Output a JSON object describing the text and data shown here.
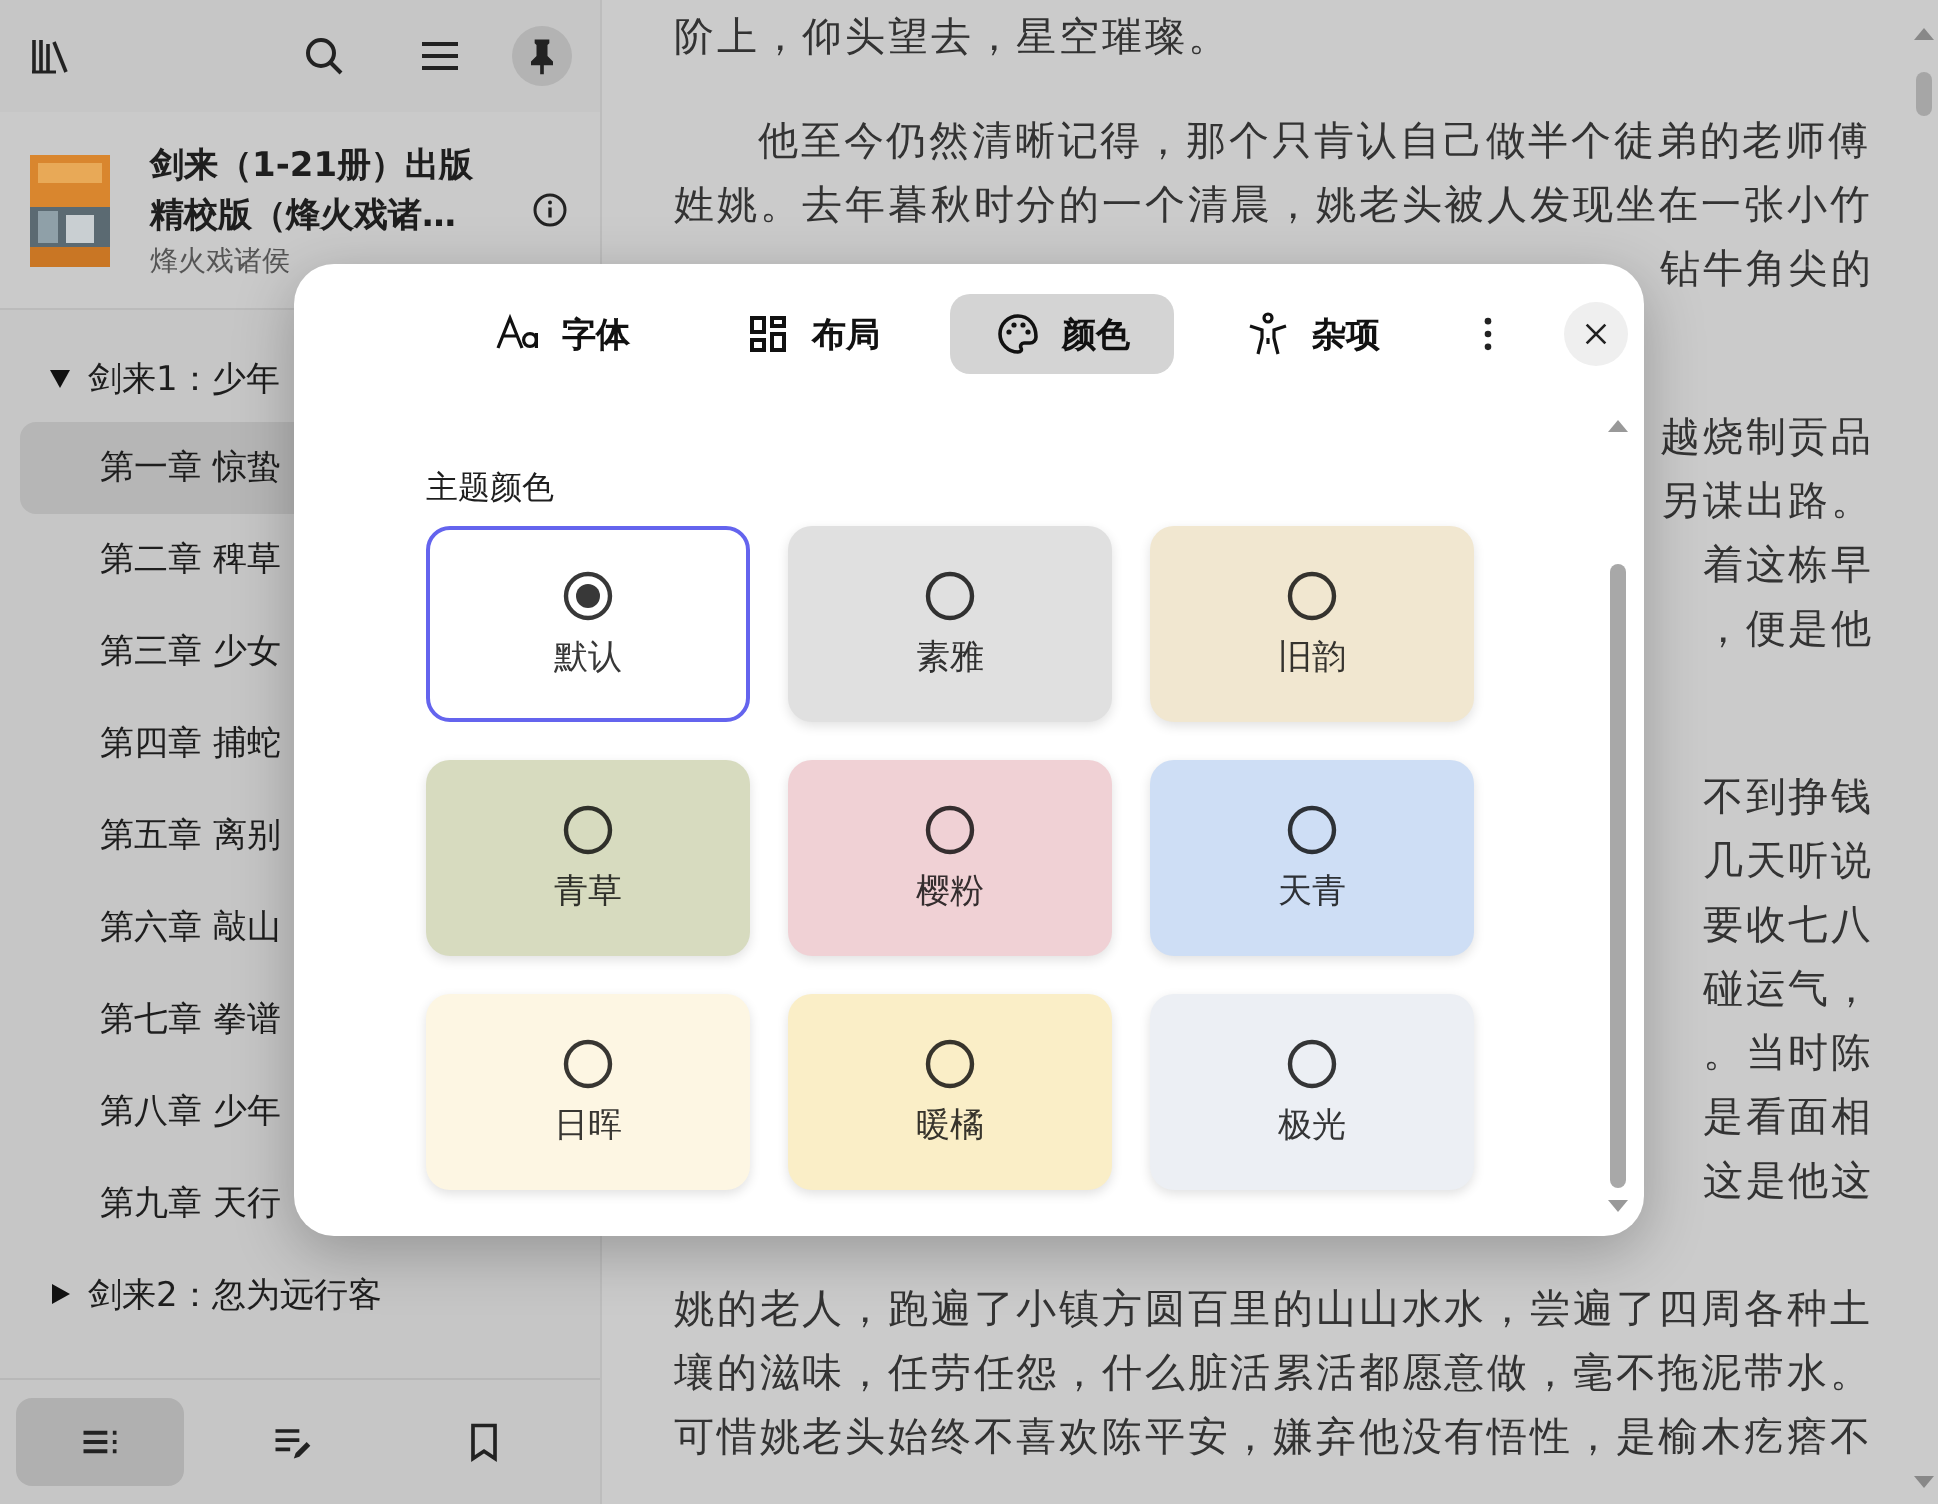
{
  "sidebar": {
    "book": {
      "title": "剑来（1-21册）出版精校版（烽火戏诸…",
      "author": "烽火戏诸侯"
    },
    "toc": [
      {
        "title": "剑来1：少年",
        "expanded": true,
        "children": [
          {
            "title": "第一章 惊蛰",
            "selected": true
          },
          {
            "title": "第二章 稗草",
            "selected": false
          },
          {
            "title": "第三章 少女",
            "selected": false
          },
          {
            "title": "第四章 捕蛇",
            "selected": false
          },
          {
            "title": "第五章 离别",
            "selected": false
          },
          {
            "title": "第六章 敲山",
            "selected": false
          },
          {
            "title": "第七章 拳谱",
            "selected": false
          },
          {
            "title": "第八章 少年",
            "selected": false
          },
          {
            "title": "第九章 天行",
            "selected": false
          }
        ]
      },
      {
        "title": "剑来2：忽为远行客",
        "expanded": false
      }
    ],
    "bottom_tabs": [
      {
        "selected": true
      },
      {
        "selected": false
      },
      {
        "selected": false
      }
    ]
  },
  "reader": {
    "paragraphs": [
      {
        "lines": [
          {
            "kind": "line",
            "text": "阶上，仰头望去，星空璀璨。"
          }
        ]
      },
      {
        "lines": [
          {
            "kind": "first",
            "text": "他至今仍然清晰记得，那个只肯认自己做半个徒弟的老师傅"
          },
          {
            "kind": "line",
            "text": "姓姚。去年暮秋时分的一个清晨，姚老头被人发现坐在一张小竹"
          },
          {
            "kind": "fragment",
            "text": "钻牛角尖的"
          },
          {
            "kind": "covered"
          }
        ]
      },
      {
        "lines": [
          {
            "kind": "fragment",
            "text": "越烧制贡品"
          },
          {
            "kind": "fragment",
            "text": "另谋出路。"
          },
          {
            "kind": "fragment",
            "text": "着这栋早"
          },
          {
            "kind": "fragment",
            "text": "，便是他"
          },
          {
            "kind": "covered"
          }
        ]
      },
      {
        "lines": [
          {
            "kind": "fragment",
            "text": "不到挣钱"
          },
          {
            "kind": "fragment",
            "text": "几天听说"
          },
          {
            "kind": "fragment",
            "text": "要收七八"
          },
          {
            "kind": "fragment",
            "text": "碰运气，"
          },
          {
            "kind": "fragment",
            "text": "。当时陈"
          },
          {
            "kind": "fragment",
            "text": "是看面相"
          },
          {
            "kind": "fragment",
            "text": "这是他这"
          },
          {
            "kind": "covered"
          },
          {
            "kind": "line",
            "text": "姚的老人，跑遍了小镇方圆百里的山山水水，尝遍了四周各种土"
          },
          {
            "kind": "line",
            "text": "壤的滋味，任劳任怨，什么脏活累活都愿意做，毫不拖泥带水。"
          },
          {
            "kind": "line",
            "text": "可惜姚老头始终不喜欢陈平安，嫌弃他没有悟性，是榆木疙瘩不"
          }
        ]
      }
    ]
  },
  "dialog": {
    "tabs": [
      {
        "label": "字体",
        "selected": false
      },
      {
        "label": "布局",
        "selected": false
      },
      {
        "label": "颜色",
        "selected": true
      },
      {
        "label": "杂项",
        "selected": false
      }
    ],
    "section_title": "主题颜色",
    "themes": [
      {
        "label": "默认",
        "selected": true,
        "color": "#ffffff"
      },
      {
        "label": "素雅",
        "selected": false,
        "color": "#e0e0e0"
      },
      {
        "label": "旧韵",
        "selected": false,
        "color": "#f1e7d0"
      },
      {
        "label": "青草",
        "selected": false,
        "color": "#d7dbbf"
      },
      {
        "label": "樱粉",
        "selected": false,
        "color": "#f0d1d5"
      },
      {
        "label": "天青",
        "selected": false,
        "color": "#cedef5"
      },
      {
        "label": "日晖",
        "selected": false,
        "color": "#fdf6e3"
      },
      {
        "label": "暖橘",
        "selected": false,
        "color": "#faeec7"
      },
      {
        "label": "极光",
        "selected": false,
        "color": "#eceff4"
      }
    ]
  }
}
